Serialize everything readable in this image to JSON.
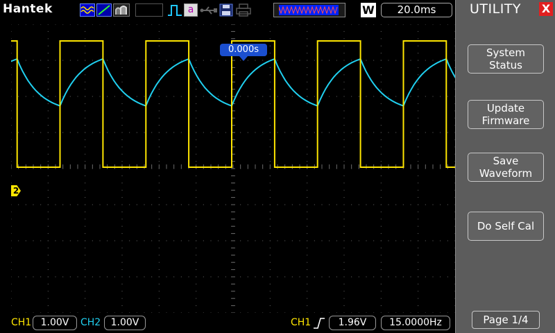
{
  "top_bar": {
    "brand": "Hantek",
    "icons": [
      "wave-mode-icon",
      "vector-mode-icon",
      "persistence-icon",
      "pulse-icon",
      "math-a-icon",
      "usb-icon",
      "save-disk-icon",
      "printer-icon"
    ],
    "math_label": "a",
    "window_label": "W",
    "timebase": "20.0ms"
  },
  "screen": {
    "trigger_position": "0.000s",
    "ch2_marker": "2",
    "colors": {
      "ch1": "#ffe600",
      "ch2": "#20d0f0",
      "grid": "#6a6a6a",
      "background": "#000000"
    }
  },
  "waveforms": {
    "ch1_square": {
      "period_ms": 46.4,
      "high_v": 3.5,
      "low_v": 0.0,
      "duty": 0.5
    },
    "ch2_triangle": {
      "period_ms": 46.4,
      "max_v": 3.0,
      "min_v": 1.7
    }
  },
  "bottom_bar": {
    "ch1_label": "CH1",
    "ch1_volts_div": "1.00V",
    "ch2_label": "CH2",
    "ch2_volts_div": "1.00V",
    "trigger_source": "CH1",
    "trigger_level": "1.96V",
    "trigger_frequency": "15.0000Hz"
  },
  "side_menu": {
    "title": "UTILITY",
    "close_label": "X",
    "buttons": [
      "System\nStatus",
      "Update\nFirmware",
      "Save\nWaveform",
      "Do Self Cal"
    ],
    "page": "Page 1/4"
  }
}
